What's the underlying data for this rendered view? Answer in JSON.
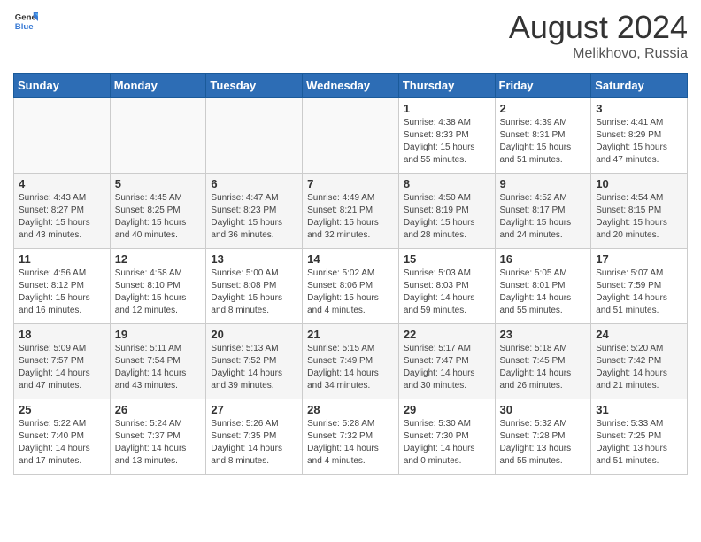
{
  "header": {
    "logo_general": "General",
    "logo_blue": "Blue",
    "month_year": "August 2024",
    "location": "Melikhovo, Russia"
  },
  "weekdays": [
    "Sunday",
    "Monday",
    "Tuesday",
    "Wednesday",
    "Thursday",
    "Friday",
    "Saturday"
  ],
  "weeks": [
    [
      {
        "day": "",
        "info": ""
      },
      {
        "day": "",
        "info": ""
      },
      {
        "day": "",
        "info": ""
      },
      {
        "day": "",
        "info": ""
      },
      {
        "day": "1",
        "info": "Sunrise: 4:38 AM\nSunset: 8:33 PM\nDaylight: 15 hours\nand 55 minutes."
      },
      {
        "day": "2",
        "info": "Sunrise: 4:39 AM\nSunset: 8:31 PM\nDaylight: 15 hours\nand 51 minutes."
      },
      {
        "day": "3",
        "info": "Sunrise: 4:41 AM\nSunset: 8:29 PM\nDaylight: 15 hours\nand 47 minutes."
      }
    ],
    [
      {
        "day": "4",
        "info": "Sunrise: 4:43 AM\nSunset: 8:27 PM\nDaylight: 15 hours\nand 43 minutes."
      },
      {
        "day": "5",
        "info": "Sunrise: 4:45 AM\nSunset: 8:25 PM\nDaylight: 15 hours\nand 40 minutes."
      },
      {
        "day": "6",
        "info": "Sunrise: 4:47 AM\nSunset: 8:23 PM\nDaylight: 15 hours\nand 36 minutes."
      },
      {
        "day": "7",
        "info": "Sunrise: 4:49 AM\nSunset: 8:21 PM\nDaylight: 15 hours\nand 32 minutes."
      },
      {
        "day": "8",
        "info": "Sunrise: 4:50 AM\nSunset: 8:19 PM\nDaylight: 15 hours\nand 28 minutes."
      },
      {
        "day": "9",
        "info": "Sunrise: 4:52 AM\nSunset: 8:17 PM\nDaylight: 15 hours\nand 24 minutes."
      },
      {
        "day": "10",
        "info": "Sunrise: 4:54 AM\nSunset: 8:15 PM\nDaylight: 15 hours\nand 20 minutes."
      }
    ],
    [
      {
        "day": "11",
        "info": "Sunrise: 4:56 AM\nSunset: 8:12 PM\nDaylight: 15 hours\nand 16 minutes."
      },
      {
        "day": "12",
        "info": "Sunrise: 4:58 AM\nSunset: 8:10 PM\nDaylight: 15 hours\nand 12 minutes."
      },
      {
        "day": "13",
        "info": "Sunrise: 5:00 AM\nSunset: 8:08 PM\nDaylight: 15 hours\nand 8 minutes."
      },
      {
        "day": "14",
        "info": "Sunrise: 5:02 AM\nSunset: 8:06 PM\nDaylight: 15 hours\nand 4 minutes."
      },
      {
        "day": "15",
        "info": "Sunrise: 5:03 AM\nSunset: 8:03 PM\nDaylight: 14 hours\nand 59 minutes."
      },
      {
        "day": "16",
        "info": "Sunrise: 5:05 AM\nSunset: 8:01 PM\nDaylight: 14 hours\nand 55 minutes."
      },
      {
        "day": "17",
        "info": "Sunrise: 5:07 AM\nSunset: 7:59 PM\nDaylight: 14 hours\nand 51 minutes."
      }
    ],
    [
      {
        "day": "18",
        "info": "Sunrise: 5:09 AM\nSunset: 7:57 PM\nDaylight: 14 hours\nand 47 minutes."
      },
      {
        "day": "19",
        "info": "Sunrise: 5:11 AM\nSunset: 7:54 PM\nDaylight: 14 hours\nand 43 minutes."
      },
      {
        "day": "20",
        "info": "Sunrise: 5:13 AM\nSunset: 7:52 PM\nDaylight: 14 hours\nand 39 minutes."
      },
      {
        "day": "21",
        "info": "Sunrise: 5:15 AM\nSunset: 7:49 PM\nDaylight: 14 hours\nand 34 minutes."
      },
      {
        "day": "22",
        "info": "Sunrise: 5:17 AM\nSunset: 7:47 PM\nDaylight: 14 hours\nand 30 minutes."
      },
      {
        "day": "23",
        "info": "Sunrise: 5:18 AM\nSunset: 7:45 PM\nDaylight: 14 hours\nand 26 minutes."
      },
      {
        "day": "24",
        "info": "Sunrise: 5:20 AM\nSunset: 7:42 PM\nDaylight: 14 hours\nand 21 minutes."
      }
    ],
    [
      {
        "day": "25",
        "info": "Sunrise: 5:22 AM\nSunset: 7:40 PM\nDaylight: 14 hours\nand 17 minutes."
      },
      {
        "day": "26",
        "info": "Sunrise: 5:24 AM\nSunset: 7:37 PM\nDaylight: 14 hours\nand 13 minutes."
      },
      {
        "day": "27",
        "info": "Sunrise: 5:26 AM\nSunset: 7:35 PM\nDaylight: 14 hours\nand 8 minutes."
      },
      {
        "day": "28",
        "info": "Sunrise: 5:28 AM\nSunset: 7:32 PM\nDaylight: 14 hours\nand 4 minutes."
      },
      {
        "day": "29",
        "info": "Sunrise: 5:30 AM\nSunset: 7:30 PM\nDaylight: 14 hours\nand 0 minutes."
      },
      {
        "day": "30",
        "info": "Sunrise: 5:32 AM\nSunset: 7:28 PM\nDaylight: 13 hours\nand 55 minutes."
      },
      {
        "day": "31",
        "info": "Sunrise: 5:33 AM\nSunset: 7:25 PM\nDaylight: 13 hours\nand 51 minutes."
      }
    ]
  ]
}
